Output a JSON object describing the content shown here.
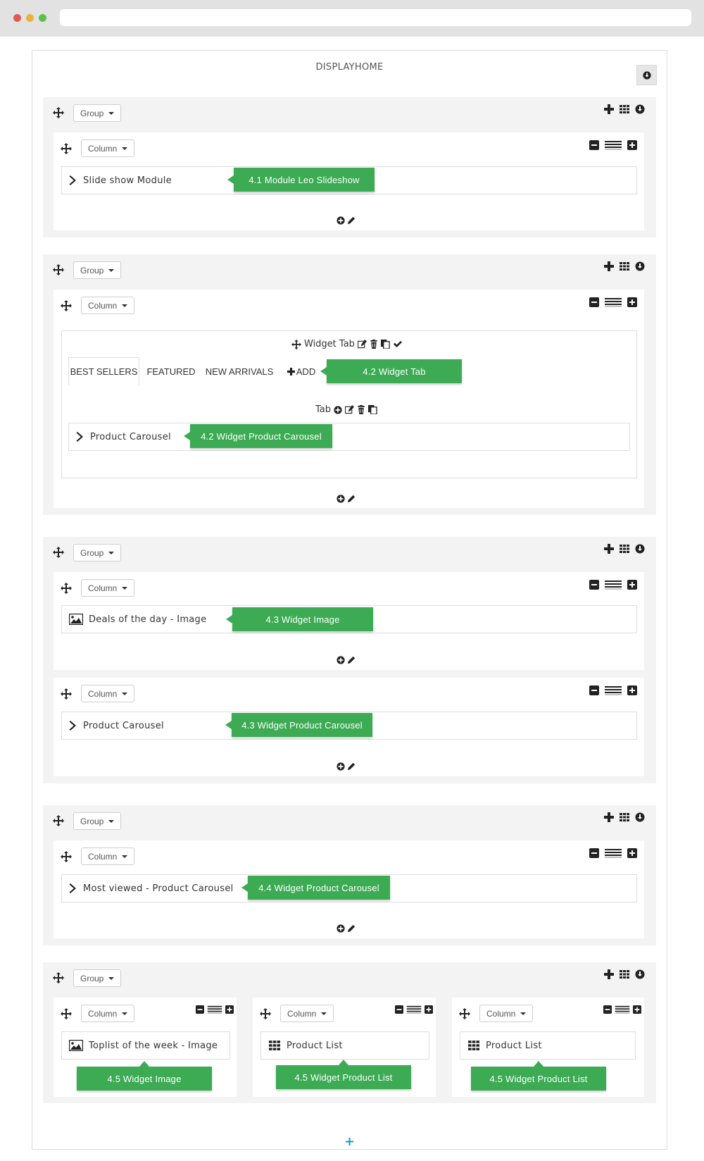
{
  "window": {
    "dot_colors": [
      "#e05a55",
      "#e8b23d",
      "#5cc04d"
    ]
  },
  "page": {
    "title": "DISPLAYHOME",
    "add_group_symbol": "+"
  },
  "labels": {
    "group": "Group",
    "column": "Column"
  },
  "icons": {
    "move": "move-arrows-icon",
    "group_tools": [
      "plus-icon",
      "grid-icon",
      "circle-down-icon"
    ],
    "column_tools": [
      "minus-square-icon",
      "lines-icon",
      "plus-square-icon"
    ],
    "add_edit": [
      "plus-circle-icon",
      "pencil-icon"
    ]
  },
  "colors": {
    "callout": "#3cab54",
    "add_group": "#1c9ad6",
    "panel": "#f3f3f3"
  },
  "groups": [
    {
      "modules": [
        {
          "label": "Slide show Module",
          "icon": "chevron-right-icon",
          "callout": "4.1 Module Leo Slideshow"
        }
      ]
    },
    {
      "widget_tab": {
        "title": "Widget Tab",
        "tabs": [
          "BEST SELLERS",
          "FEATURED",
          "NEW ARRIVALS"
        ],
        "add_label": "ADD",
        "tab_callout": "4.2 Widget Tab",
        "tab_label": "Tab",
        "module": {
          "label": "Product Carousel",
          "icon": "chevron-right-icon",
          "callout": "4.2 Widget Product Carousel"
        }
      }
    },
    {
      "columns": [
        {
          "label": "Deals of the day - Image",
          "icon": "image-icon",
          "callout": "4.3 Widget Image"
        },
        {
          "label": "Product Carousel",
          "icon": "chevron-right-icon",
          "callout": "4.3 Widget Product Carousel"
        }
      ]
    },
    {
      "modules": [
        {
          "label": "Most viewed - Product Carousel",
          "icon": "chevron-right-icon",
          "callout": "4.4 Widget Product Carousel"
        }
      ]
    },
    {
      "columns": [
        {
          "label": "Toplist of the week - Image",
          "icon": "image-icon",
          "callout": "4.5 Widget Image"
        },
        {
          "label": "Product List",
          "icon": "grid-icon",
          "callout": "4.5 Widget Product List"
        },
        {
          "label": "Product List",
          "icon": "grid-icon",
          "callout": "4.5 Widget Product List"
        }
      ]
    }
  ]
}
